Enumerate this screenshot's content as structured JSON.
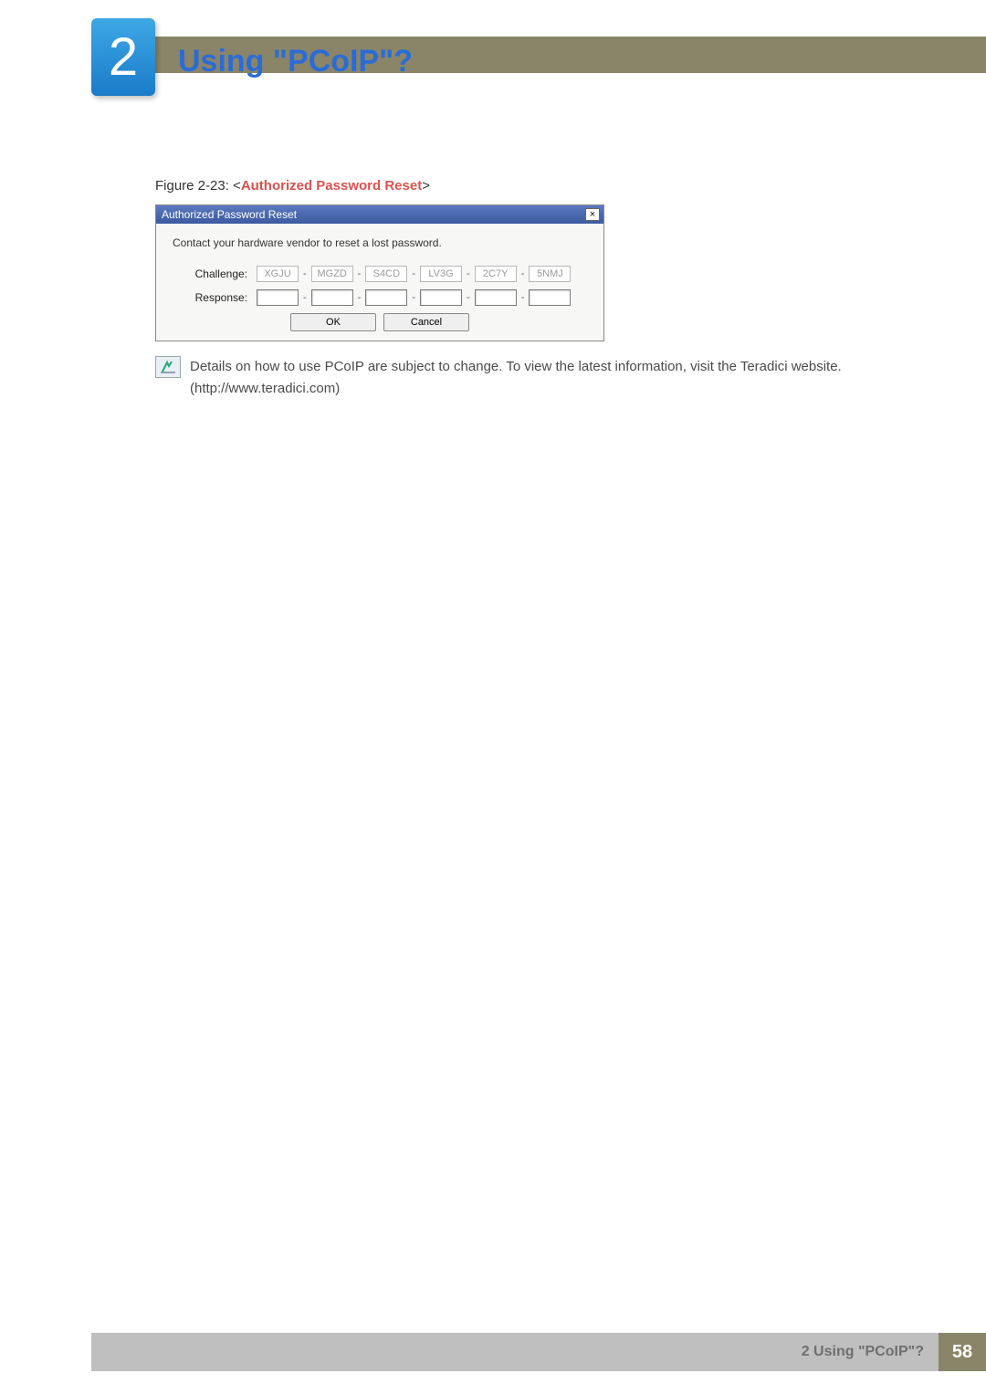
{
  "header": {
    "chapter_number": "2",
    "chapter_title": "Using \"PCoIP\"?"
  },
  "figure": {
    "prefix": "Figure 2-23: <",
    "title": "Authorized Password Reset",
    "suffix": ">"
  },
  "dialog": {
    "title": "Authorized Password Reset",
    "close_glyph": "×",
    "message": "Contact your hardware vendor to reset a lost password.",
    "challenge_label": "Challenge:",
    "response_label": "Response:",
    "challenge_segments": [
      "XGJU",
      "MGZD",
      "S4CD",
      "LV3G",
      "2C7Y",
      "5NMJ"
    ],
    "response_segments": [
      "",
      "",
      "",
      "",
      "",
      ""
    ],
    "dash": "-",
    "btn_ok": "OK",
    "btn_cancel": "Cancel"
  },
  "note": {
    "text": "Details on how to use PCoIP are subject to change. To view the latest information, visit the Teradici website. (http://www.teradici.com)"
  },
  "footer": {
    "text": "2 Using \"PCoIP\"?",
    "page": "58"
  }
}
